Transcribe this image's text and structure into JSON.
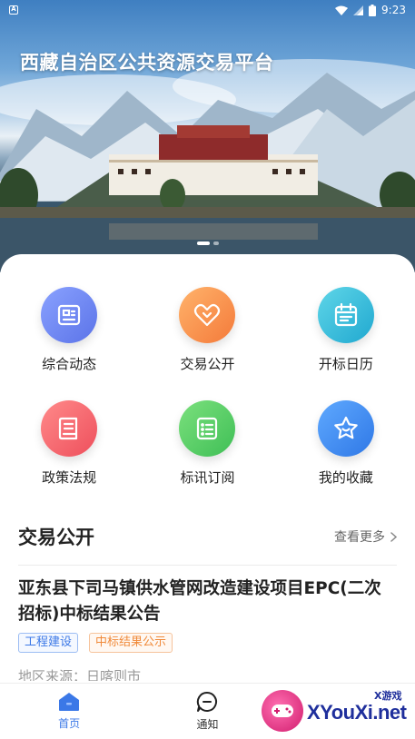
{
  "status_bar": {
    "time": "9:23"
  },
  "banner": {
    "title": "西藏自治区公共资源交易平台"
  },
  "grid": [
    {
      "label": "综合动态",
      "icon": "news-icon",
      "color_from": "#8aa2ff",
      "color_to": "#5b73e8"
    },
    {
      "label": "交易公开",
      "icon": "handshake-icon",
      "color_from": "#ffb36b",
      "color_to": "#f47a3a"
    },
    {
      "label": "开标日历",
      "icon": "calendar-icon",
      "color_from": "#5fd6e8",
      "color_to": "#20a8d0"
    },
    {
      "label": "政策法规",
      "icon": "book-icon",
      "color_from": "#ff8a8a",
      "color_to": "#ee4f5c"
    },
    {
      "label": "标讯订阅",
      "icon": "list-icon",
      "color_from": "#7be07d",
      "color_to": "#3fbf56"
    },
    {
      "label": "我的收藏",
      "icon": "star-icon",
      "color_from": "#5fa9ff",
      "color_to": "#2f78e6"
    }
  ],
  "section": {
    "title": "交易公开",
    "more": "查看更多"
  },
  "news": {
    "title": "亚东县下司马镇供水管网改造建设项目EPC(二次招标)中标结果公告",
    "tags": [
      "工程建设",
      "中标结果公示"
    ],
    "meta": "地区来源：日喀则市"
  },
  "nav": [
    {
      "label": "首页",
      "icon": "home-icon",
      "active": true
    },
    {
      "label": "通知",
      "icon": "message-icon",
      "active": false
    }
  ],
  "watermark": {
    "text": "XYouXi.net",
    "small": "X游戏"
  },
  "colors": {
    "accent": "#3b78e7",
    "tag_orange": "#f08a3a"
  }
}
